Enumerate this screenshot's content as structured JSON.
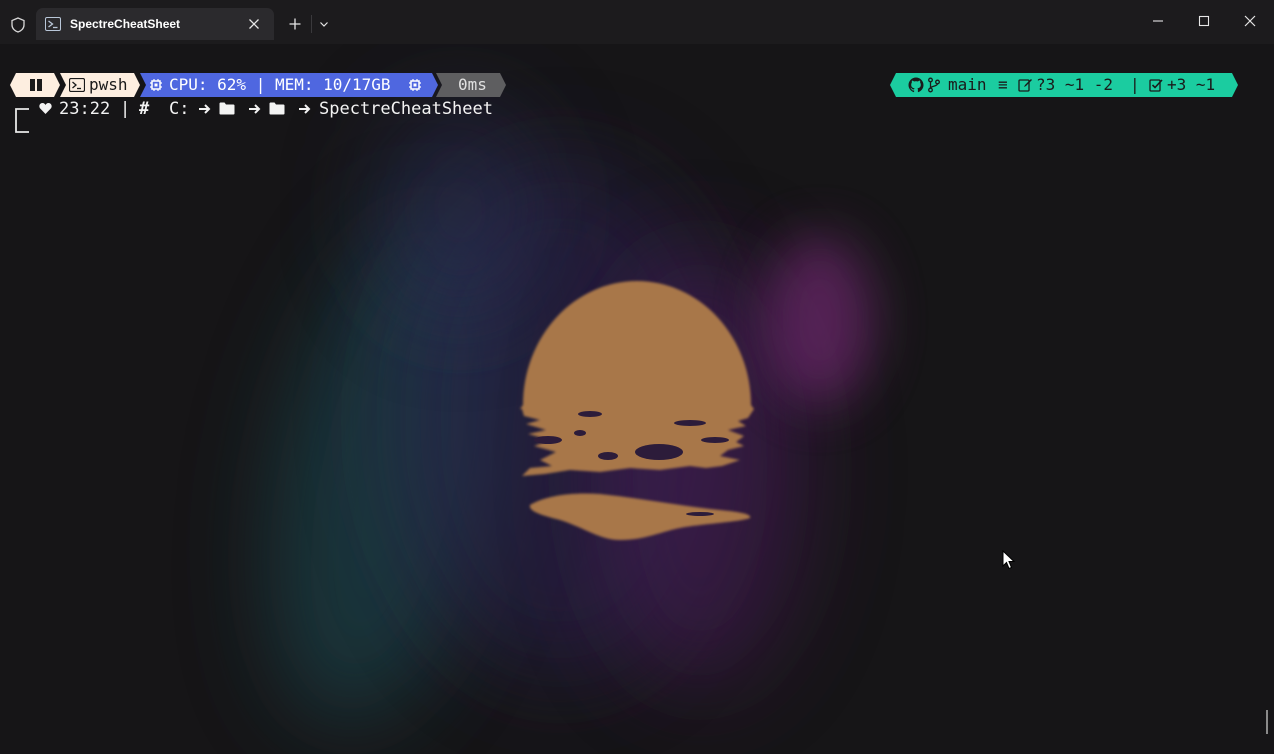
{
  "window": {
    "tab_title": "SpectreCheatSheet"
  },
  "prompt": {
    "segments": {
      "pause_icon": "pause-icon",
      "shell": "pwsh",
      "sys": "CPU: 62% | MEM: 10/17GB",
      "time": "0ms",
      "git_branch": "main",
      "git_sync": "≡",
      "git_changes": "?3 ~1 -2",
      "git_sep": "|",
      "git_staged": "+3 ~1"
    },
    "line2": {
      "clock": "23:22",
      "sep": "|",
      "hash": "#",
      "drive": "C:",
      "folder": "SpectreCheatSheet"
    }
  },
  "colors": {
    "shell_bg": "#fdeee0",
    "sys_bg": "#4f67e0",
    "time_bg": "#6b6b6b",
    "git_bg": "#1bcca0",
    "sun": "#c48a4e"
  },
  "icons": [
    "shield-icon",
    "powershell-icon",
    "close-icon",
    "plus-icon",
    "chevron-down-icon",
    "minimize-icon",
    "maximize-icon",
    "github-icon",
    "branch-icon",
    "edit-icon",
    "check-icon",
    "heart-icon",
    "folder-icon",
    "arrow-right-icon",
    "chip-icon",
    "terminal-icon"
  ]
}
